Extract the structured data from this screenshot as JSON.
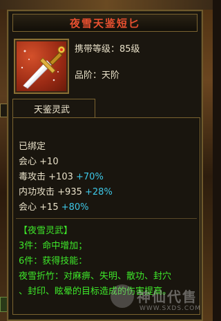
{
  "item": {
    "name": "夜雪天鉴短匕",
    "carry_level": "携带等级：85级",
    "grade": "品阶：天阶",
    "icon": "dagger-icon"
  },
  "section_tab": "天鉴灵武",
  "details": {
    "bound": "已绑定",
    "stats": [
      {
        "label": "会心",
        "base": "+10",
        "bonus": ""
      },
      {
        "label": "毒攻击",
        "base": "+103",
        "bonus": "+70%"
      },
      {
        "label": "内功攻击",
        "base": "+935",
        "bonus": "+28%"
      },
      {
        "label": "会心",
        "base": "+15",
        "bonus": "+80%"
      }
    ],
    "set_name": "【夜雪灵武】",
    "set_3": "3件：命中增加；",
    "set_6": "6件：获得技能：",
    "skill_line1": "夜雪折竹：对麻痹、失明、散功、封穴",
    "skill_line2": "、封印、眩晕的目标造成的伤害提高。"
  },
  "watermark": {
    "text": "神仙代售",
    "url": "WWW.SXDS.COM"
  },
  "colors": {
    "title": "#e85030",
    "bonus": "#3ec8e8",
    "set": "#3ee82a",
    "text": "#e8e0c8"
  }
}
